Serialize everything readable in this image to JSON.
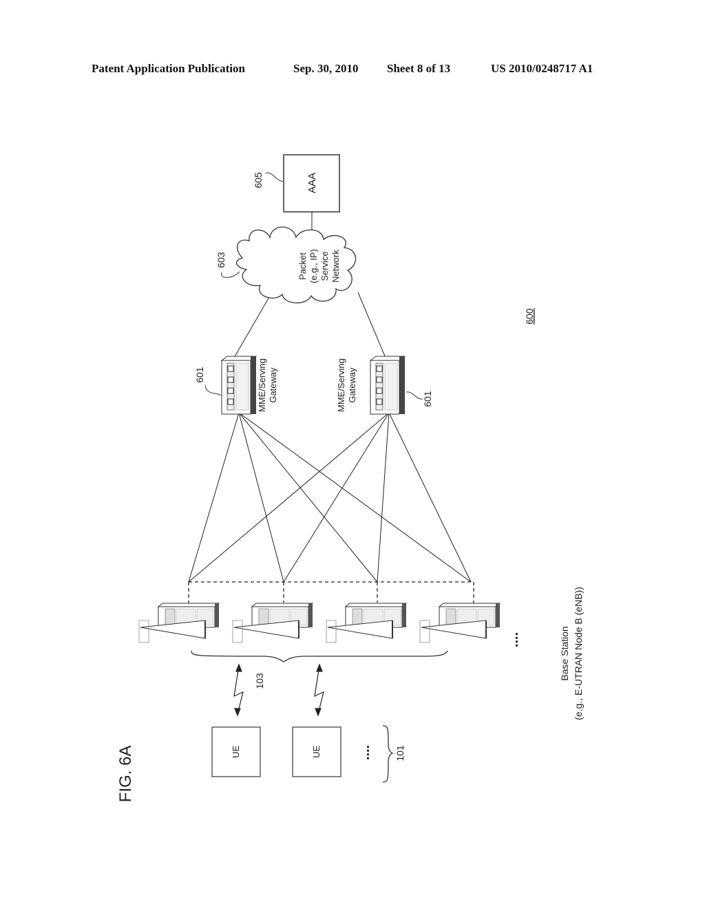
{
  "header": {
    "publication": "Patent Application Publication",
    "date": "Sep. 30, 2010",
    "sheet": "Sheet 8 of 13",
    "number": "US 2010/0248717 A1"
  },
  "figure": {
    "label": "FIG. 6A",
    "system_ref": "600",
    "aaa": {
      "label": "AAA",
      "ref": "605"
    },
    "network": {
      "lines": [
        "Packet",
        "(e.g., IP)",
        "Service",
        "Network"
      ],
      "ref": "603"
    },
    "gateways": [
      {
        "lines": [
          "MME/Serving",
          "Gateway"
        ],
        "ref": "601"
      },
      {
        "lines": [
          "MME/Serving",
          "Gateway"
        ],
        "ref": "601"
      }
    ],
    "base_stations": {
      "count": 4,
      "ellipsis": "....",
      "lines": [
        "Base Station",
        "(e.g., E-UTRAN Node B (eNB))"
      ],
      "ref": "103"
    },
    "ues": {
      "labels": [
        "UE",
        "UE"
      ],
      "ellipsis": "....",
      "ref": "101"
    }
  }
}
